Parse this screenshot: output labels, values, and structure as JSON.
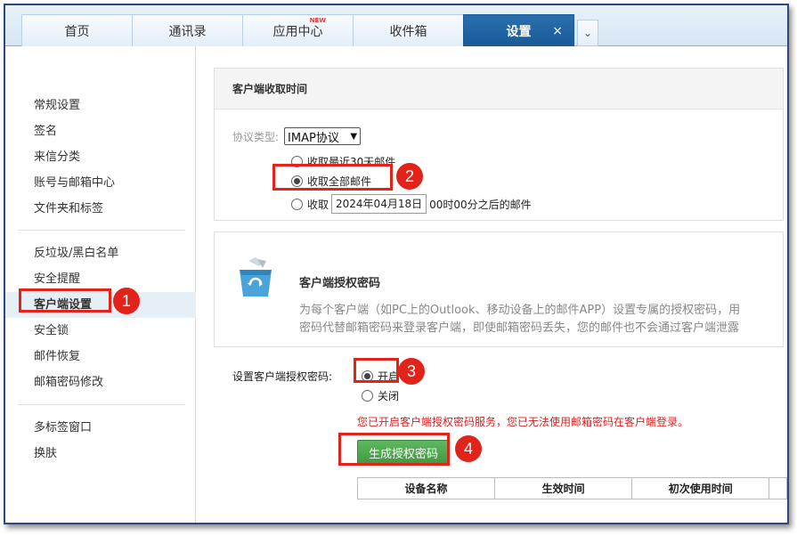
{
  "tabs": [
    {
      "label": "首页"
    },
    {
      "label": "通讯录"
    },
    {
      "label": "应用中心",
      "badge": "NEW"
    },
    {
      "label": "收件箱"
    },
    {
      "label": "设置",
      "active": true,
      "close": "×"
    }
  ],
  "tab_more": "⌄",
  "sidebar": {
    "group1": [
      "常规设置",
      "签名",
      "来信分类",
      "账号与邮箱中心",
      "文件夹和标签"
    ],
    "group2": [
      "反垃圾/黑白名单",
      "安全提醒",
      "客户端设置",
      "安全锁",
      "邮件恢复",
      "邮箱密码修改"
    ],
    "group3": [
      "多标签窗口",
      "换肤"
    ],
    "selected": "客户端设置"
  },
  "receive_panel": {
    "title": "客户端收取时间",
    "protocol_label": "协议类型:",
    "protocol_value": "IMAP协议",
    "option_30days": "收取最近30天邮件",
    "option_all": "收取全部邮件",
    "option_since_prefix": "收取",
    "option_since_date": "2024年04月18日",
    "option_since_suffix": "00时00分之后的邮件",
    "selected": "option_all"
  },
  "auth_panel": {
    "title": "客户端授权密码",
    "desc_line1": "为每个客户端（如PC上的Outlook、移动设备上的邮件APP）设置专属的授权密码，用",
    "desc_line2": "密码代替邮箱密码来登录客户端，即使邮箱密码丢失，您的邮件也不会通过客户端泄露"
  },
  "auth_setting": {
    "label": "设置客户端授权密码:",
    "open": "开启",
    "close": "关闭",
    "selected": "open",
    "warning": "您已开启客户端授权密码服务，您已无法使用邮箱密码在客户端登录。",
    "generate_button": "生成授权密码",
    "table_headers": [
      "设备名称",
      "生效时间",
      "初次使用时间"
    ]
  },
  "annotations": [
    "1",
    "2",
    "3",
    "4"
  ],
  "colors": {
    "accent": "#1a5a97",
    "highlight": "#e2231a",
    "button": "#4caf50",
    "warning": "#e02020"
  }
}
